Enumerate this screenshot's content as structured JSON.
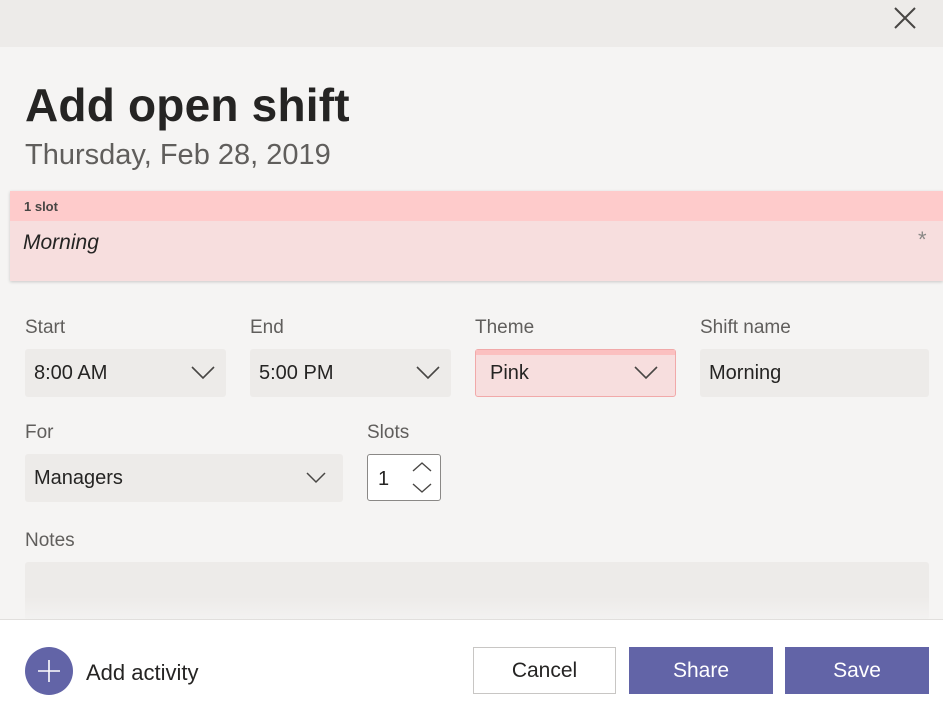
{
  "dialog": {
    "title": "Add open shift",
    "date": "Thursday, Feb 28, 2019"
  },
  "preview": {
    "slots": "1 slot",
    "shift_name": "Morning",
    "required_marker": "*",
    "color": "#fecbcb"
  },
  "fields": {
    "start": {
      "label": "Start",
      "value": "8:00 AM"
    },
    "end": {
      "label": "End",
      "value": "5:00 PM"
    },
    "theme": {
      "label": "Theme",
      "value": "Pink"
    },
    "shift_name": {
      "label": "Shift name",
      "value": "Morning"
    },
    "for": {
      "label": "For",
      "value": "Managers"
    },
    "slots": {
      "label": "Slots",
      "value": "1"
    },
    "notes": {
      "label": "Notes",
      "value": ""
    }
  },
  "footer": {
    "add_activity_label": "Add activity",
    "cancel_label": "Cancel",
    "share_label": "Share",
    "save_label": "Save"
  },
  "colors": {
    "accent": "#6264a7",
    "theme_pink": "#f7dede"
  },
  "icons": {
    "close": "close-icon",
    "chevron": "chevron-down-icon",
    "add": "plus-icon"
  }
}
